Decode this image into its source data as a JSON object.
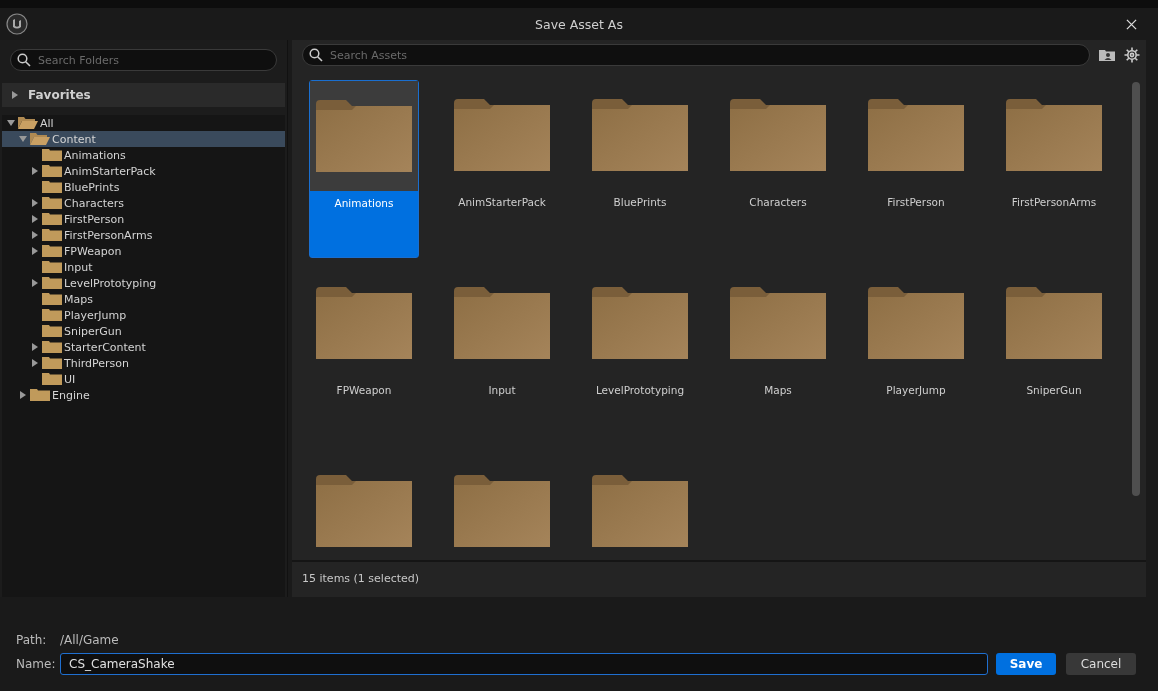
{
  "window": {
    "title": "Save Asset As"
  },
  "folder_search": {
    "placeholder": "Search Folders"
  },
  "favorites": {
    "label": "Favorites",
    "expanded": false
  },
  "tree": [
    {
      "label": "All",
      "expanded": true,
      "selected": false,
      "children": [
        {
          "label": "Content",
          "expanded": true,
          "selected": true,
          "children": [
            {
              "label": "Animations",
              "selected": false
            },
            {
              "label": "AnimStarterPack",
              "expanded": false,
              "selected": false
            },
            {
              "label": "BluePrints",
              "selected": false
            },
            {
              "label": "Characters",
              "expanded": false,
              "selected": false
            },
            {
              "label": "FirstPerson",
              "expanded": false,
              "selected": false
            },
            {
              "label": "FirstPersonArms",
              "expanded": false,
              "selected": false
            },
            {
              "label": "FPWeapon",
              "expanded": false,
              "selected": false
            },
            {
              "label": "Input",
              "selected": false
            },
            {
              "label": "LevelPrototyping",
              "expanded": false,
              "selected": false
            },
            {
              "label": "Maps",
              "selected": false
            },
            {
              "label": "PlayerJump",
              "selected": false
            },
            {
              "label": "SniperGun",
              "selected": false
            },
            {
              "label": "StarterContent",
              "expanded": false,
              "selected": false
            },
            {
              "label": "ThirdPerson",
              "expanded": false,
              "selected": false
            },
            {
              "label": "UI",
              "selected": false
            }
          ]
        },
        {
          "label": "Engine",
          "expanded": false,
          "selected": false
        }
      ]
    }
  ],
  "asset_search": {
    "placeholder": "Search Assets"
  },
  "assets": [
    {
      "label": "Animations",
      "selected": true
    },
    {
      "label": "AnimStarterPack",
      "selected": false
    },
    {
      "label": "BluePrints",
      "selected": false
    },
    {
      "label": "Characters",
      "selected": false
    },
    {
      "label": "FirstPerson",
      "selected": false
    },
    {
      "label": "FirstPersonArms",
      "selected": false
    },
    {
      "label": "FPWeapon",
      "selected": false
    },
    {
      "label": "Input",
      "selected": false
    },
    {
      "label": "LevelPrototyping",
      "selected": false
    },
    {
      "label": "Maps",
      "selected": false
    },
    {
      "label": "PlayerJump",
      "selected": false
    },
    {
      "label": "SniperGun",
      "selected": false
    },
    {
      "selected": false
    },
    {
      "selected": false
    },
    {
      "selected": false
    }
  ],
  "status_bar": "15 items (1 selected)",
  "path": {
    "label": "Path:",
    "value": "/All/Game"
  },
  "name": {
    "label": "Name:",
    "value": "CS_CameraShake"
  },
  "buttons": [
    {
      "label": "Save",
      "kind": "primary"
    },
    {
      "label": "Cancel",
      "kind": "secondary"
    }
  ]
}
